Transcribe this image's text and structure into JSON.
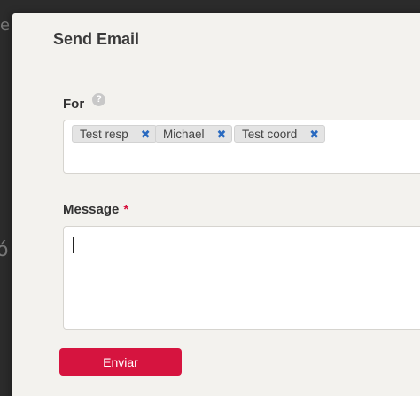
{
  "backdrop": {
    "fragment_top": "e",
    "fragment_mid": "ó"
  },
  "modal": {
    "title": "Send Email"
  },
  "for_field": {
    "label": "For",
    "help_glyph": "?",
    "tags": [
      {
        "label": "Test resp",
        "remove_glyph": "✖"
      },
      {
        "label": "Michael",
        "remove_glyph": "✖"
      },
      {
        "label": "Test coord",
        "remove_glyph": "✖"
      }
    ]
  },
  "message_field": {
    "label": "Message",
    "required_marker": "*",
    "value": ""
  },
  "actions": {
    "send_label": "Enviar"
  },
  "colors": {
    "accent": "#d6143f",
    "tag_remove": "#2a6ac0",
    "modal_bg": "#f3f2ee",
    "backdrop": "#2b2b2b"
  }
}
